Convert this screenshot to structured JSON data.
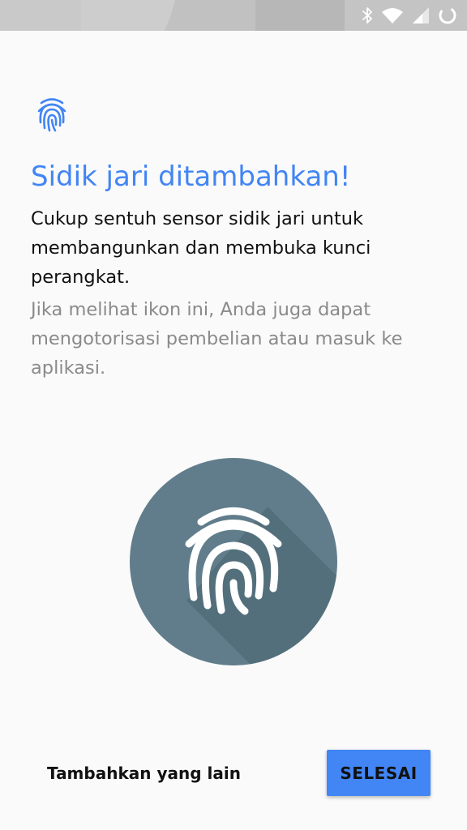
{
  "status_bar": {
    "icons": [
      "bluetooth-icon",
      "wifi-icon",
      "cell-signal-icon",
      "battery-charging-icon"
    ]
  },
  "header": {
    "icon": "fingerprint-icon",
    "title": "Sidik jari ditambahkan!"
  },
  "content": {
    "description": "Cukup sentuh sensor sidik jari untuk membangunkan dan membuka kunci perangkat.",
    "secondary_text": "Jika melihat ikon ini, Anda juga dapat mengotorisasi pembelian atau masuk ke aplikasi.",
    "illustration_icon": "fingerprint-icon"
  },
  "actions": {
    "add_another_label": "Tambahkan yang lain",
    "done_label": "SELESAI"
  },
  "colors": {
    "accent": "#4285f4",
    "illustration_circle": "#607d8b",
    "background": "#fafafa"
  }
}
